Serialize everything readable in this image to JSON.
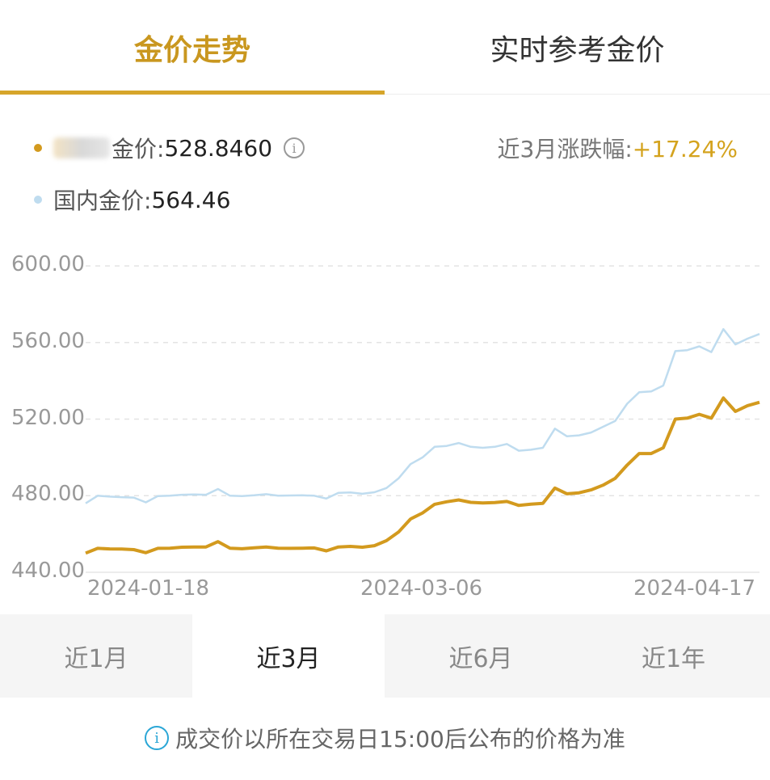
{
  "tabs": {
    "trend": "金价走势",
    "realtime": "实时参考金价"
  },
  "legend": {
    "series1_label": "金价:",
    "series1_value": "528.8460",
    "series2_label": "国内金价:",
    "series2_value": "564.46",
    "info_glyph": "i"
  },
  "change": {
    "label": "近3月涨跌幅:",
    "value": "+17.24%"
  },
  "ranges": {
    "r1": "近1月",
    "r2": "近3月",
    "r3": "近6月",
    "r4": "近1年"
  },
  "footnote": {
    "icon": "i",
    "text": "成交价以所在交易日15:00后公布的价格为准"
  },
  "colors": {
    "accent": "#d6a52a",
    "series1": "#d39a1e",
    "series2": "#bfdcef"
  },
  "chart_data": {
    "type": "line",
    "y_tick_labels": [
      "600.00",
      "560.00",
      "520.00",
      "480.00",
      "440.00"
    ],
    "ylim": [
      440,
      600
    ],
    "x_tick_labels": [
      "2024-01-18",
      "2024-03-06",
      "2024-04-17"
    ],
    "grid": true,
    "series": [
      {
        "values": [
          450.0,
          452.5,
          452.2,
          452.1,
          451.8,
          450.2,
          452.5,
          452.6,
          453.1,
          453.2,
          453.2,
          456.0,
          452.6,
          452.3,
          452.8,
          453.2,
          452.6,
          452.5,
          452.6,
          452.7,
          451.2,
          453.2,
          453.5,
          453.1,
          453.9,
          456.5,
          461.0,
          467.8,
          471.0,
          475.5,
          476.8,
          477.8,
          476.5,
          476.2,
          476.4,
          477.0,
          474.9,
          475.6,
          476.0,
          484.0,
          481.0,
          481.5,
          483.0,
          485.5,
          489.0,
          496.0,
          502.0,
          502.0,
          505.0,
          520.0,
          520.5,
          522.5,
          520.5,
          531.0,
          524.0,
          527.0,
          528.8
        ]
      },
      {
        "values": [
          476.0,
          480.0,
          479.5,
          479.2,
          479.0,
          476.5,
          479.8,
          480.0,
          480.5,
          480.6,
          480.5,
          483.5,
          480.0,
          479.8,
          480.2,
          480.8,
          480.0,
          480.1,
          480.2,
          480.0,
          478.5,
          481.5,
          481.7,
          481.0,
          481.8,
          484.0,
          489.0,
          496.5,
          500.0,
          505.5,
          506.0,
          507.5,
          505.5,
          505.0,
          505.5,
          507.0,
          503.5,
          504.0,
          505.0,
          515.0,
          511.0,
          511.5,
          513.0,
          516.0,
          519.0,
          528.0,
          534.0,
          534.5,
          537.5,
          555.5,
          556.0,
          558.0,
          555.0,
          567.0,
          559.0,
          562.0,
          564.46
        ]
      }
    ]
  }
}
